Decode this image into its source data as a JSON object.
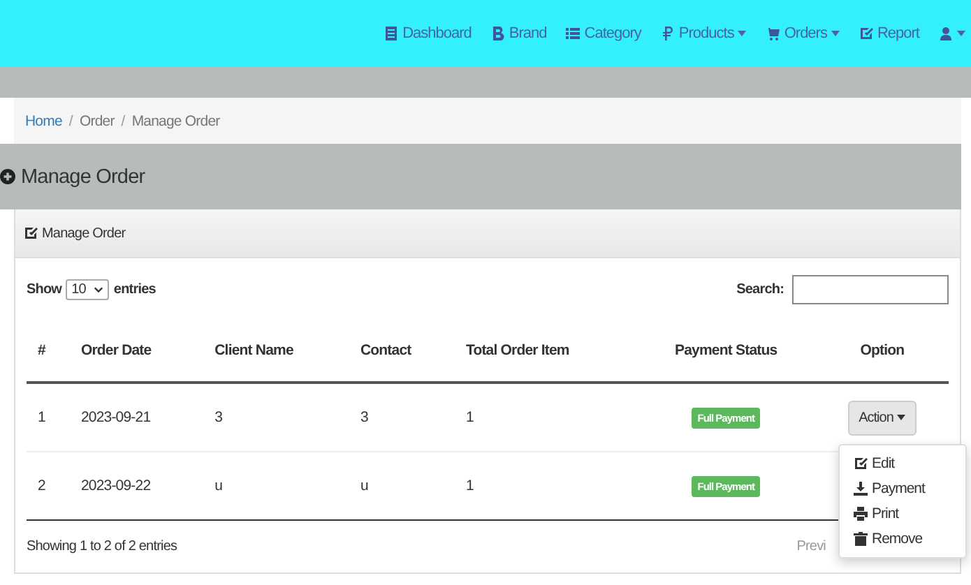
{
  "navbar": {
    "items": [
      {
        "label": "Dashboard",
        "dropdown": false
      },
      {
        "label": "Brand",
        "dropdown": false
      },
      {
        "label": "Category",
        "dropdown": false
      },
      {
        "label": "Products",
        "dropdown": true
      },
      {
        "label": "Orders",
        "dropdown": true
      },
      {
        "label": "Report",
        "dropdown": false
      }
    ],
    "user_menu": {
      "dropdown": true
    }
  },
  "breadcrumb": [
    {
      "label": "Home",
      "link": true
    },
    {
      "separator": "/",
      "label": "Order",
      "link": false
    },
    {
      "separator": "/",
      "label": "Manage Order",
      "link": false
    }
  ],
  "page_title": "Manage Order",
  "panel": {
    "title": "Manage Order",
    "length_control": {
      "prefix": "Show",
      "value": "10",
      "suffix": "entries"
    },
    "search": {
      "label": "Search:"
    },
    "table": {
      "columns": [
        "#",
        "Order Date",
        "Client Name",
        "Contact",
        "Total Order Item",
        "Payment Status",
        "Option"
      ],
      "rows": [
        {
          "cells": [
            "1",
            "2023-09-21",
            "3",
            "3",
            "1"
          ],
          "status": "Full Payment",
          "action": "Action"
        },
        {
          "cells": [
            "2",
            "2023-09-22",
            "u",
            "u",
            "1"
          ],
          "status": "Full Payment"
        }
      ]
    },
    "info": "Showing 1 to 2 of 2 entries",
    "pagination": "Previ"
  },
  "action_menu": [
    {
      "label": "Edit"
    },
    {
      "label": "Payment"
    },
    {
      "label": "Print"
    },
    {
      "label": "Remove"
    }
  ]
}
